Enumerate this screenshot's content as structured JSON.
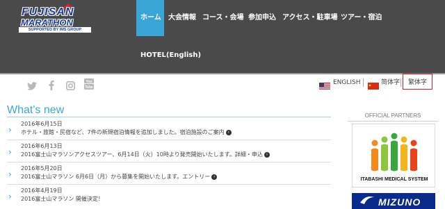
{
  "logo": {
    "line1": "FUJISAN",
    "line2": "MARATHON",
    "tagline": "SUPPORTED BY IMS GROUP"
  },
  "nav": {
    "items": [
      "ホーム",
      "大会情報",
      "コース・会場",
      "参加申込",
      "アクセス・駐車場",
      "ツアー・宿泊"
    ],
    "second_row": "HOTEL(English)",
    "active_index": 0
  },
  "social": {
    "icons": [
      "twitter-icon",
      "facebook-icon",
      "instagram-icon",
      "youtube-icon"
    ],
    "youtube_label": "You Tube"
  },
  "languages": {
    "english": "ENGLISH",
    "simplified": "简体字",
    "traditional": "繁体字",
    "selected": "繁体字"
  },
  "news": {
    "title": "What's new",
    "items": [
      {
        "date": "2016年6月15日",
        "text": "ホテル・旅館・民宿など、7件の新規宿泊情報を追加しました。宿泊施設のご案内"
      },
      {
        "date": "2016年6月13日",
        "text": "2016富士山マラソンアクセスツアー、6月14日（火）10時より発売開始いたします。詳細・申込"
      },
      {
        "date": "2016年5月20日",
        "text": "2016富士山マラソン 6月6日（月）から募集を開始いたします。エントリー"
      },
      {
        "date": "2016年4月19日",
        "text": "2016富士山マラソン 開催決定！"
      }
    ]
  },
  "partners": {
    "title": "OFFICIAL PARTNERS",
    "first_caption": "ITABASHI MEDICAL SYSTEM",
    "second_name": "MIZUNO"
  },
  "colors": {
    "header_bg": "#4a4a4a",
    "accent": "#3aa6d8",
    "highlight_border": "#c8202a"
  }
}
